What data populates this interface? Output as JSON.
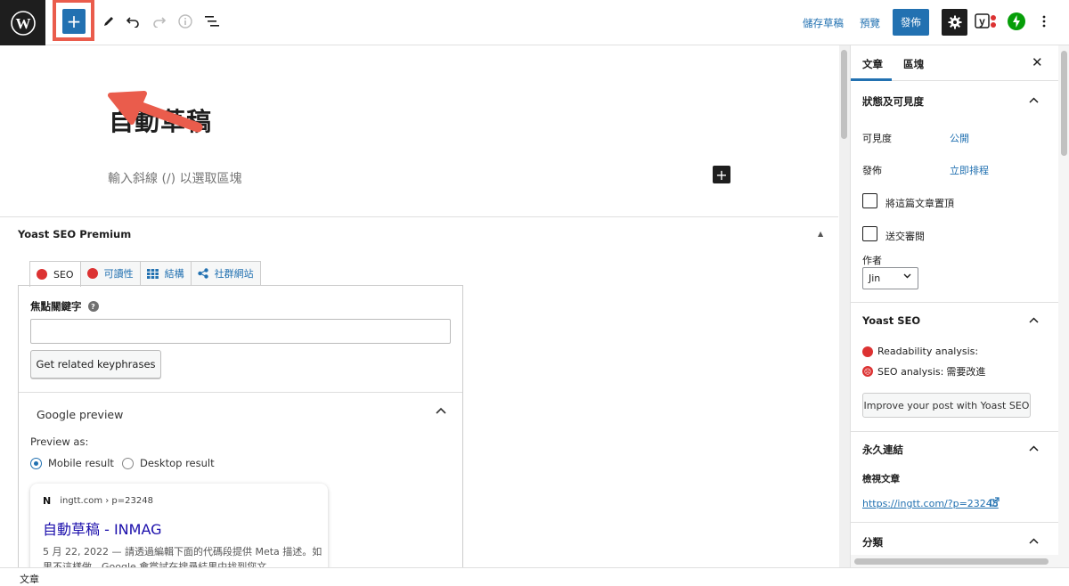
{
  "topbar": {
    "save_draft": "儲存草稿",
    "preview": "預覽",
    "publish": "發佈"
  },
  "editor": {
    "post_title": "自動草稿",
    "block_placeholder": "輸入斜線 (/) 以選取區塊"
  },
  "yoast_metabox": {
    "title": "Yoast SEO Premium",
    "tabs": [
      {
        "label": "SEO"
      },
      {
        "label": "可讀性"
      },
      {
        "label": "結構"
      },
      {
        "label": "社群網站"
      }
    ],
    "focus_keyphrase_label": "焦點關鍵字",
    "focus_keyphrase_value": "",
    "related_button": "Get related keyphrases",
    "google_preview_title": "Google preview",
    "preview_as_label": "Preview as:",
    "mobile_result": "Mobile result",
    "desktop_result": "Desktop result",
    "serp": {
      "favicon": "N",
      "site": "ingtt.com › p=23248",
      "title": "自動草稿 - INMAG",
      "description": "5 月 22, 2022 — 請透過編輯下面的代碼段提供 Meta 描述。如果不這樣做，Google 會嘗試在搜尋結果中找到您文"
    }
  },
  "sidebar": {
    "tab_post": "文章",
    "tab_block": "區塊",
    "status_section": "狀態及可見度",
    "visibility_label": "可見度",
    "visibility_value": "公開",
    "publish_label": "發佈",
    "publish_value": "立即排程",
    "sticky_label": "將這篇文章置頂",
    "review_label": "送交審閱",
    "author_label": "作者",
    "author_value": "Jin",
    "yoast_section": "Yoast SEO",
    "readability": "Readability analysis:",
    "seo_analysis": "SEO analysis:",
    "seo_status": "需要改進",
    "improve_button": "Improve your post with Yoast SEO",
    "permalink_section": "永久連結",
    "view_post_label": "檢視文章",
    "permalink_url": "https://ingtt.com/?p=23248",
    "category_section": "分類"
  },
  "footer": {
    "breadcrumb": "文章"
  },
  "colors": {
    "accent": "#2271b1",
    "annotation": "#ea5c4c",
    "error_red": "#dc3232",
    "jetpack_green": "#069e08"
  }
}
